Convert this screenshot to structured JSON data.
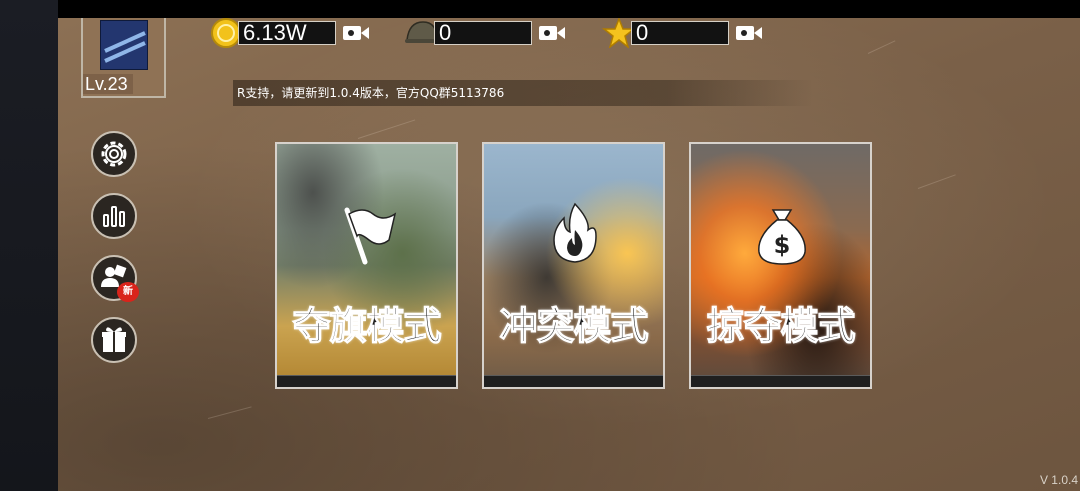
{
  "player": {
    "level_label": "Lv.23"
  },
  "resources": [
    {
      "name": "coin",
      "icon": "coin-icon",
      "value": "6.13W",
      "action_icon": "video-camera-icon"
    },
    {
      "name": "helmet",
      "icon": "helmet-icon",
      "value": "0",
      "action_icon": "video-camera-icon"
    },
    {
      "name": "star",
      "icon": "star-icon",
      "value": "0",
      "action_icon": "video-camera-icon"
    }
  ],
  "notice": {
    "text": "R支持，请更新到1.0.4版本，官方QQ群5113786"
  },
  "side_menu": [
    {
      "name": "settings",
      "icon": "gear-icon"
    },
    {
      "name": "stats",
      "icon": "bar-chart-icon"
    },
    {
      "name": "friends",
      "icon": "users-icon",
      "badge": "新"
    },
    {
      "name": "gift",
      "icon": "gift-icon"
    }
  ],
  "modes": [
    {
      "name": "capture-the-flag",
      "title": "夺旗模式",
      "icon": "flag-icon"
    },
    {
      "name": "conflict",
      "title": "冲突模式",
      "icon": "fire-icon"
    },
    {
      "name": "plunder",
      "title": "掠夺模式",
      "icon": "money-bag-icon"
    }
  ],
  "version": "V 1.0.4",
  "colors": {
    "rank_blue": "#23366f",
    "new_badge_red": "#d9241b",
    "coin_gold": "#f2c21b",
    "star_gold": "#f4c21e"
  }
}
